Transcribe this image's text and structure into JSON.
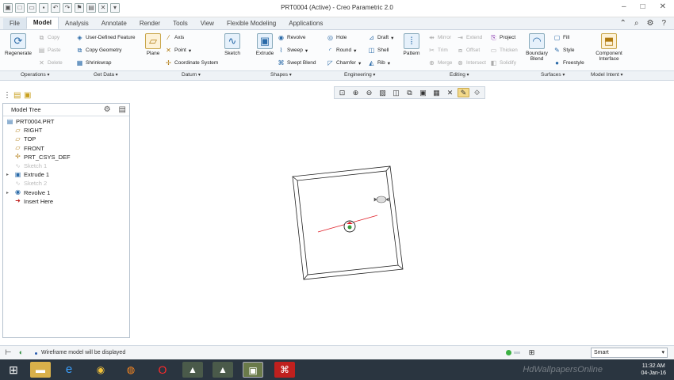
{
  "app": {
    "title": "PRT0004 (Active) - Creo Parametric 2.0"
  },
  "tabs": [
    "File",
    "Model",
    "Analysis",
    "Annotate",
    "Render",
    "Tools",
    "View",
    "Flexible Modeling",
    "Applications"
  ],
  "ribbon": {
    "regenerate": "Regenerate",
    "copy": "Copy",
    "paste": "Paste",
    "delete": "Delete",
    "user_defined_feature": "User-Defined Feature",
    "copy_geometry": "Copy Geometry",
    "shrinkwrap": "Shrinkwrap",
    "plane": "Plane",
    "axis": "Axis",
    "point": "Point",
    "coordinate_system": "Coordinate System",
    "sketch": "Sketch",
    "extrude": "Extrude",
    "revolve": "Revolve",
    "sweep": "Sweep",
    "swept_blend": "Swept Blend",
    "hole": "Hole",
    "round": "Round",
    "chamfer": "Chamfer",
    "draft": "Draft",
    "shell": "Shell",
    "rib": "Rib",
    "pattern": "Pattern",
    "mirror": "Mirror",
    "trim": "Trim",
    "merge": "Merge",
    "extend": "Extend",
    "offset": "Offset",
    "intersect": "Intersect",
    "project": "Project",
    "thicken": "Thicken",
    "solidify": "Solidify",
    "boundary_blend": "Boundary Blend",
    "fill": "Fill",
    "style": "Style",
    "freestyle": "Freestyle",
    "component_interface": "Component Interface"
  },
  "groups": [
    "Operations",
    "Get Data",
    "Datum",
    "Shapes",
    "Engineering",
    "Editing",
    "Surfaces",
    "Model Intent"
  ],
  "model_tree": {
    "title": "Model Tree",
    "items": [
      {
        "label": "PRT0004.PRT",
        "icon": "part-icon",
        "dim": false,
        "expandable": false
      },
      {
        "label": "RIGHT",
        "icon": "datum-plane-icon",
        "dim": false,
        "expandable": false
      },
      {
        "label": "TOP",
        "icon": "datum-plane-icon",
        "dim": false,
        "expandable": false
      },
      {
        "label": "FRONT",
        "icon": "datum-plane-icon",
        "dim": false,
        "expandable": false
      },
      {
        "label": "PRT_CSYS_DEF",
        "icon": "csys-icon",
        "dim": false,
        "expandable": false
      },
      {
        "label": "Sketch 1",
        "icon": "sketch-icon",
        "dim": true,
        "expandable": false
      },
      {
        "label": "Extrude 1",
        "icon": "extrude-icon",
        "dim": false,
        "expandable": true
      },
      {
        "label": "Sketch 2",
        "icon": "sketch-icon",
        "dim": true,
        "expandable": false
      },
      {
        "label": "Revolve 1",
        "icon": "revolve-icon",
        "dim": false,
        "expandable": true
      },
      {
        "label": "Insert Here",
        "icon": "insert-arrow-icon",
        "dim": false,
        "expandable": false
      }
    ]
  },
  "status": {
    "message": "Wireframe model will be displayed",
    "selection_filter": "Smart"
  },
  "taskbar": {
    "time": "11:32 AM",
    "date": "04-Jan-16",
    "watermark": "HdWallpapersOnline"
  },
  "colors": {
    "accent": "#2a6aa8",
    "sketch_line": "#e0202a",
    "active_view_button": "#f3d98a"
  }
}
